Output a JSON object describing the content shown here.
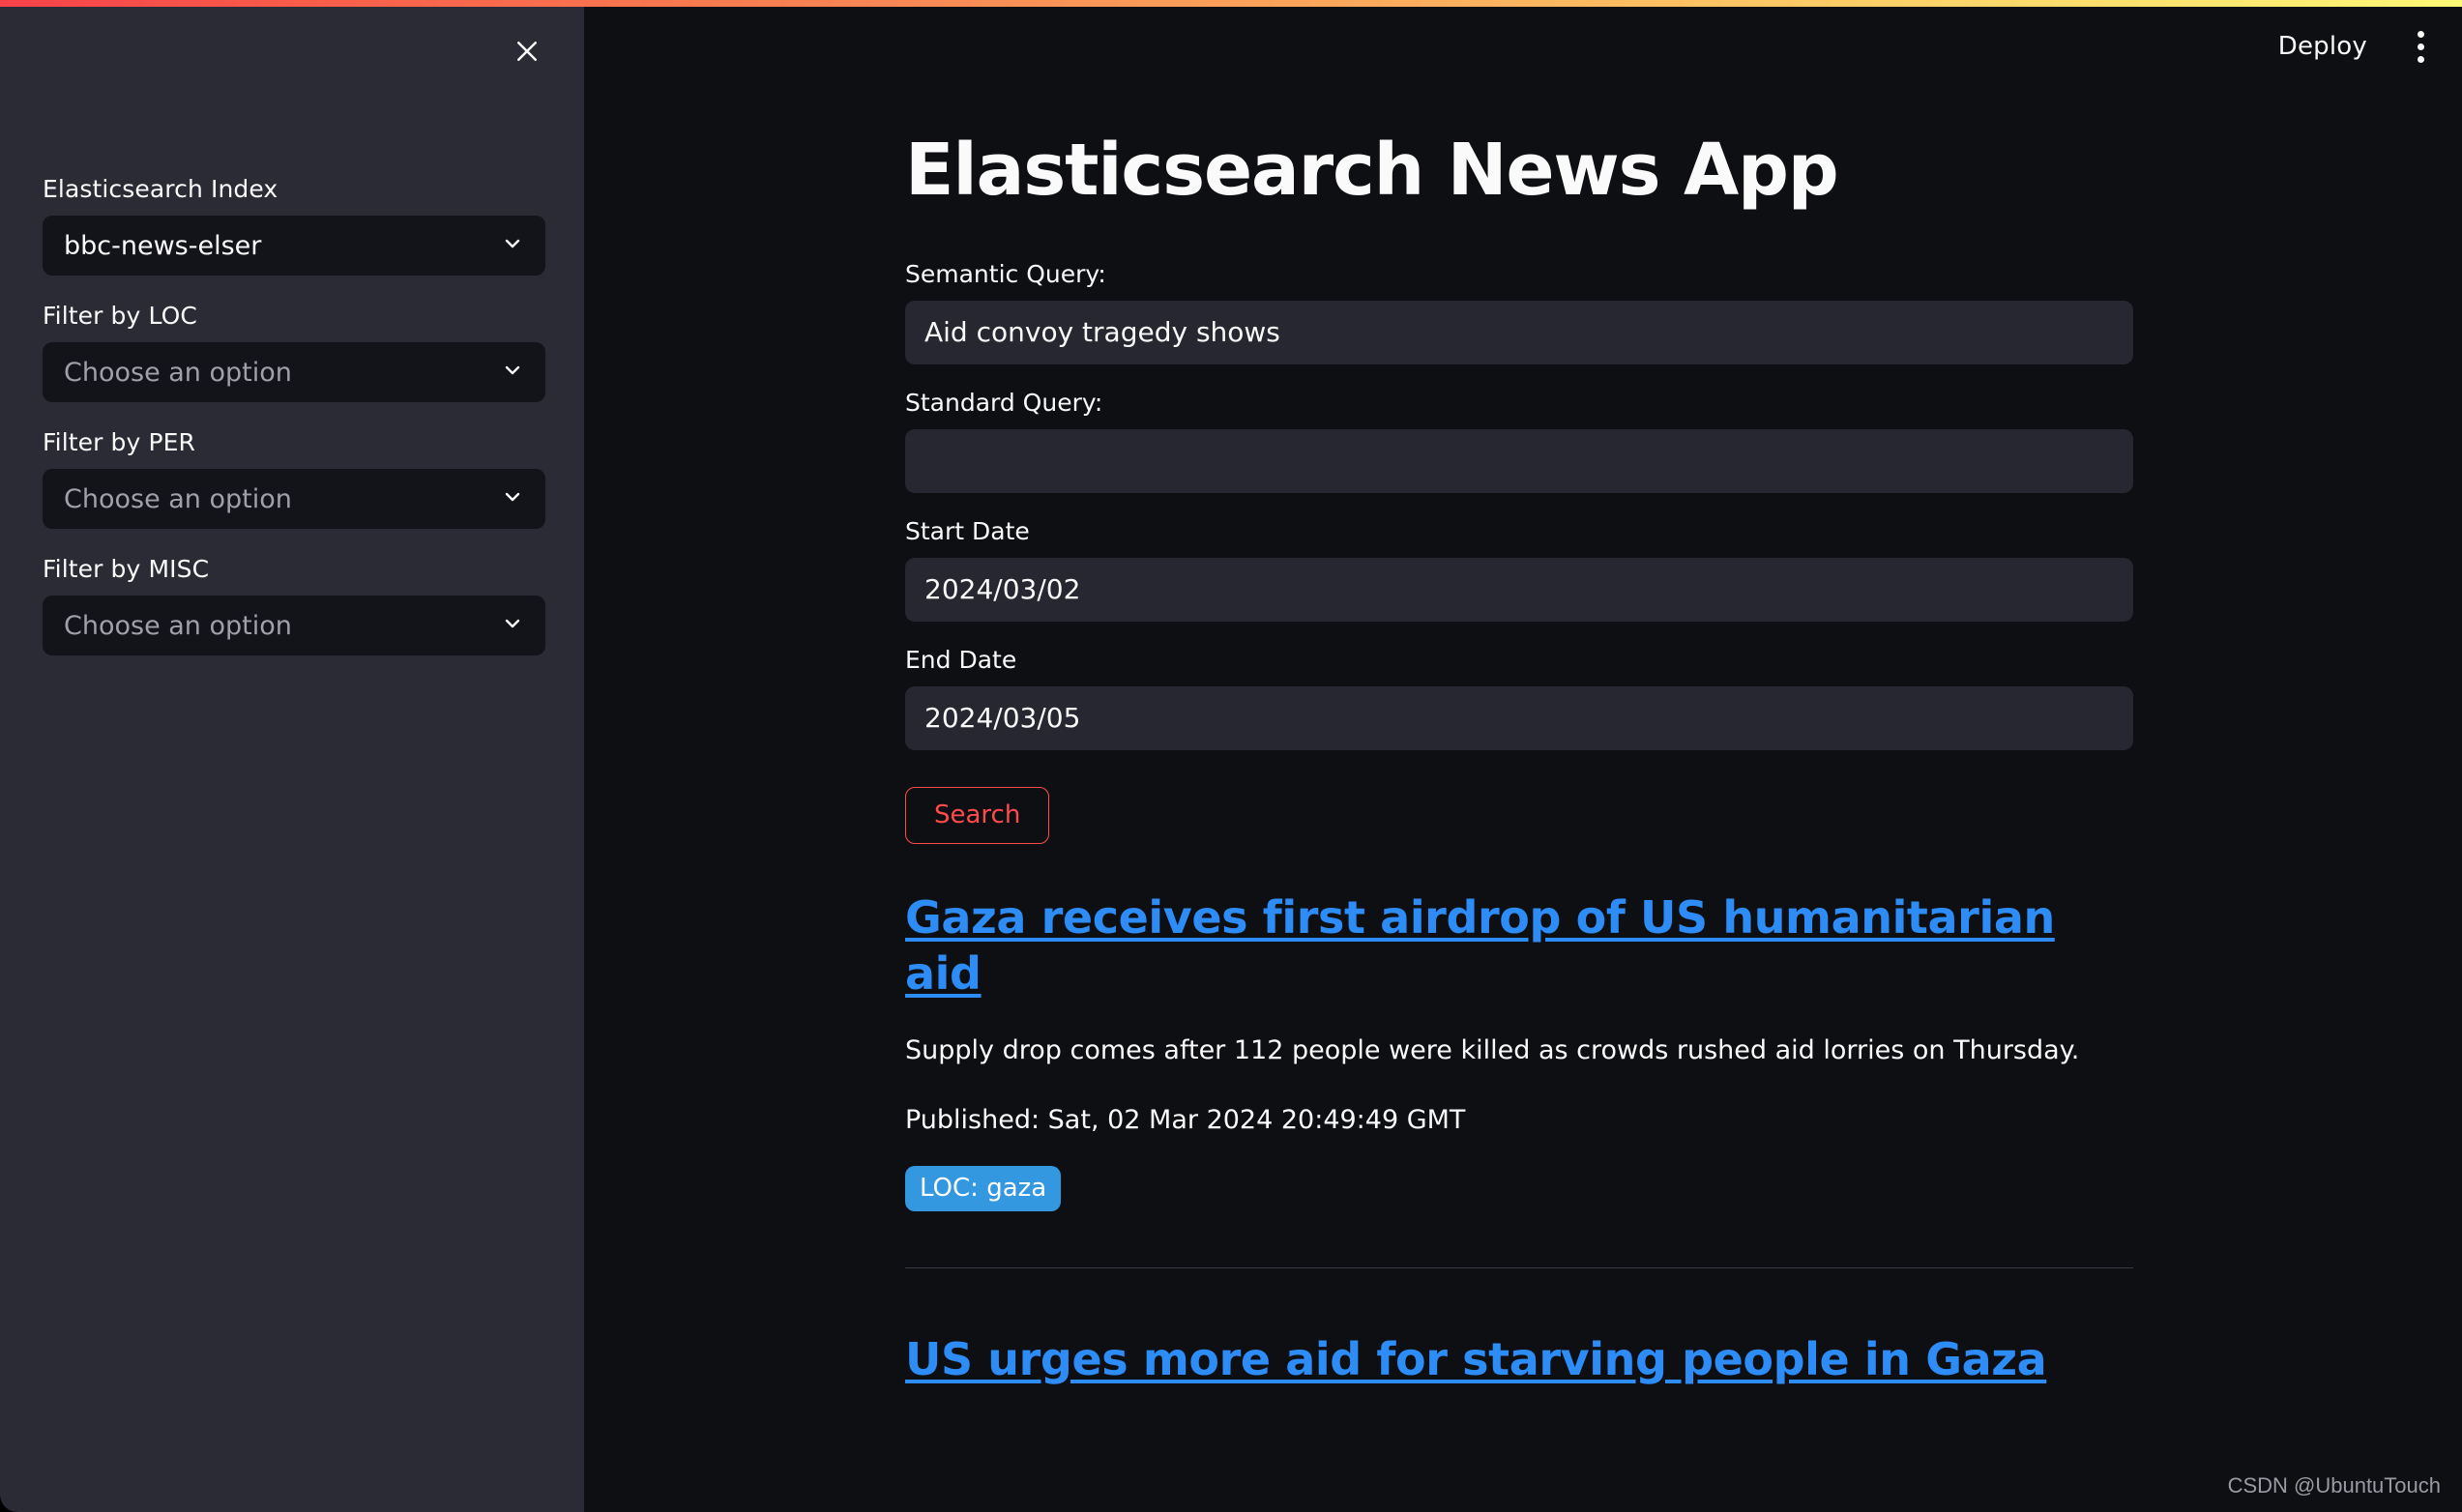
{
  "theme": {
    "accent_red": "#ff4b4b",
    "link_blue": "#2d8cf6",
    "tag_blue": "#3498e0",
    "sidebar_bg": "#2a2b35",
    "main_bg": "#0e0f13",
    "input_bg": "#262730",
    "select_bg": "#131419",
    "gradient_start": "#f7424a",
    "gradient_end": "#fdf877"
  },
  "sidebar": {
    "close_icon": "close-icon",
    "fields": [
      {
        "label": "Elasticsearch Index",
        "value": "bbc-news-elser",
        "is_placeholder": false,
        "icon": "chevron-down-icon"
      },
      {
        "label": "Filter by LOC",
        "value": "Choose an option",
        "is_placeholder": true,
        "icon": "chevron-down-icon"
      },
      {
        "label": "Filter by PER",
        "value": "Choose an option",
        "is_placeholder": true,
        "icon": "chevron-down-icon"
      },
      {
        "label": "Filter by MISC",
        "value": "Choose an option",
        "is_placeholder": true,
        "icon": "chevron-down-icon"
      }
    ]
  },
  "header": {
    "deploy_label": "Deploy",
    "menu_icon": "kebab-menu-icon"
  },
  "main": {
    "title": "Elasticsearch News App",
    "form": {
      "semantic_query_label": "Semantic Query:",
      "semantic_query_value": "Aid convoy tragedy shows",
      "semantic_query_placeholder": "",
      "standard_query_label": "Standard Query:",
      "standard_query_value": "",
      "standard_query_placeholder": "",
      "start_date_label": "Start Date",
      "start_date_value": "2024/03/02",
      "end_date_label": "End Date",
      "end_date_value": "2024/03/05",
      "search_label": "Search"
    },
    "results": [
      {
        "title": "Gaza receives first airdrop of US humanitarian aid",
        "summary": "Supply drop comes after 112 people were killed as crowds rushed aid lorries on Thursday.",
        "published": "Published: Sat, 02 Mar 2024 20:49:49 GMT",
        "tags": [
          "LOC: gaza"
        ]
      },
      {
        "title": "US urges more aid for starving people in Gaza",
        "summary": "",
        "published": "",
        "tags": []
      }
    ]
  },
  "watermark": "CSDN @UbuntuTouch"
}
